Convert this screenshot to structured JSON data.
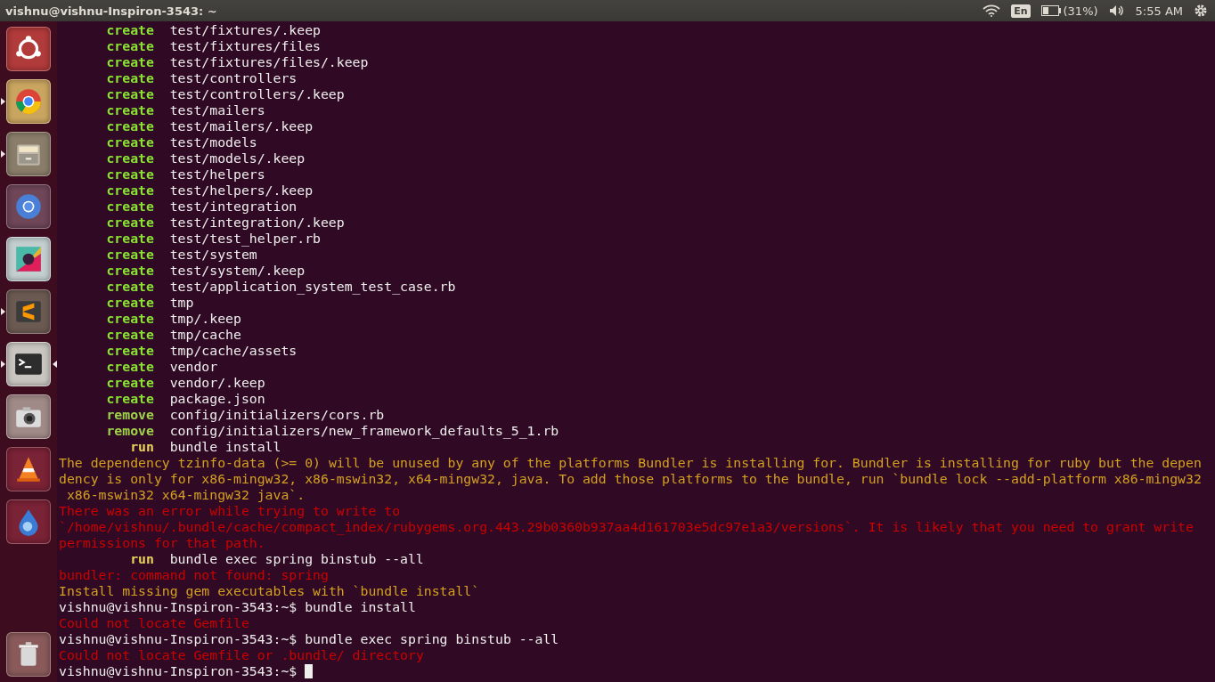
{
  "top_bar": {
    "title": "vishnu@vishnu-Inspiron-3543: ~",
    "keyboard": "En",
    "battery": "(31%)",
    "clock": "5:55 AM"
  },
  "launcher": [
    {
      "running": false,
      "active": false
    },
    {
      "running": true,
      "active": false
    },
    {
      "running": true,
      "active": false
    },
    {
      "running": false,
      "active": false
    },
    {
      "running": false,
      "active": false
    },
    {
      "running": true,
      "active": false
    },
    {
      "running": true,
      "active": true
    },
    {
      "running": false,
      "active": false
    },
    {
      "running": false,
      "active": false
    },
    {
      "running": false,
      "active": false
    },
    {
      "kind": "trash",
      "running": false,
      "active": false
    }
  ],
  "terminal": {
    "lines": [
      {
        "kind": "status",
        "verb": "create",
        "path": "test/fixtures/.keep",
        "color": "#8ae234"
      },
      {
        "kind": "status",
        "verb": "create",
        "path": "test/fixtures/files",
        "color": "#8ae234"
      },
      {
        "kind": "status",
        "verb": "create",
        "path": "test/fixtures/files/.keep",
        "color": "#8ae234"
      },
      {
        "kind": "status",
        "verb": "create",
        "path": "test/controllers",
        "color": "#8ae234"
      },
      {
        "kind": "status",
        "verb": "create",
        "path": "test/controllers/.keep",
        "color": "#8ae234"
      },
      {
        "kind": "status",
        "verb": "create",
        "path": "test/mailers",
        "color": "#8ae234"
      },
      {
        "kind": "status",
        "verb": "create",
        "path": "test/mailers/.keep",
        "color": "#8ae234"
      },
      {
        "kind": "status",
        "verb": "create",
        "path": "test/models",
        "color": "#8ae234"
      },
      {
        "kind": "status",
        "verb": "create",
        "path": "test/models/.keep",
        "color": "#8ae234"
      },
      {
        "kind": "status",
        "verb": "create",
        "path": "test/helpers",
        "color": "#8ae234"
      },
      {
        "kind": "status",
        "verb": "create",
        "path": "test/helpers/.keep",
        "color": "#8ae234"
      },
      {
        "kind": "status",
        "verb": "create",
        "path": "test/integration",
        "color": "#8ae234"
      },
      {
        "kind": "status",
        "verb": "create",
        "path": "test/integration/.keep",
        "color": "#8ae234"
      },
      {
        "kind": "status",
        "verb": "create",
        "path": "test/test_helper.rb",
        "color": "#8ae234"
      },
      {
        "kind": "status",
        "verb": "create",
        "path": "test/system",
        "color": "#8ae234"
      },
      {
        "kind": "status",
        "verb": "create",
        "path": "test/system/.keep",
        "color": "#8ae234"
      },
      {
        "kind": "status",
        "verb": "create",
        "path": "test/application_system_test_case.rb",
        "color": "#8ae234"
      },
      {
        "kind": "status",
        "verb": "create",
        "path": "tmp",
        "color": "#8ae234"
      },
      {
        "kind": "status",
        "verb": "create",
        "path": "tmp/.keep",
        "color": "#8ae234"
      },
      {
        "kind": "status",
        "verb": "create",
        "path": "tmp/cache",
        "color": "#8ae234"
      },
      {
        "kind": "status",
        "verb": "create",
        "path": "tmp/cache/assets",
        "color": "#8ae234"
      },
      {
        "kind": "status",
        "verb": "create",
        "path": "vendor",
        "color": "#8ae234"
      },
      {
        "kind": "status",
        "verb": "create",
        "path": "vendor/.keep",
        "color": "#8ae234"
      },
      {
        "kind": "status",
        "verb": "create",
        "path": "package.json",
        "color": "#8ae234"
      },
      {
        "kind": "status",
        "verb": "remove",
        "path": "config/initializers/cors.rb",
        "color": "#9ed34a"
      },
      {
        "kind": "status",
        "verb": "remove",
        "path": "config/initializers/new_framework_defaults_5_1.rb",
        "color": "#9ed34a"
      },
      {
        "kind": "status",
        "verb": "run",
        "path": "bundle install",
        "color": "#e9d35a"
      },
      {
        "kind": "message",
        "text": "The dependency tzinfo-data (>= 0) will be unused by any of the platforms Bundler is installing for. Bundler is installing for ruby but the depen",
        "color": "#d4a020"
      },
      {
        "kind": "message",
        "text": "dency is only for x86-mingw32, x86-mswin32, x64-mingw32, java. To add those platforms to the bundle, run `bundle lock --add-platform x86-mingw32",
        "color": "#d4a020"
      },
      {
        "kind": "message",
        "text": " x86-mswin32 x64-mingw32 java`.",
        "color": "#d4a020"
      },
      {
        "kind": "message",
        "text": "There was an error while trying to write to",
        "color": "#cc0000"
      },
      {
        "kind": "message",
        "text": "`/home/vishnu/.bundle/cache/compact_index/rubygems.org.443.29b0360b937aa4d161703e5dc97e1a3/versions`. It is likely that you need to grant write",
        "color": "#cc0000"
      },
      {
        "kind": "message",
        "text": "permissions for that path.",
        "color": "#cc0000"
      },
      {
        "kind": "status",
        "verb": "run",
        "path": "bundle exec spring binstub --all",
        "color": "#e9d35a"
      },
      {
        "kind": "message",
        "text": "bundler: command not found: spring",
        "color": "#cc0000"
      },
      {
        "kind": "message",
        "text": "Install missing gem executables with `bundle install`",
        "color": "#d4a020"
      },
      {
        "kind": "prompt",
        "prompt": "vishnu@vishnu-Inspiron-3543:~$",
        "command": "bundle install",
        "cursor": false
      },
      {
        "kind": "message",
        "text": "Could not locate Gemfile",
        "color": "#cc0000"
      },
      {
        "kind": "prompt",
        "prompt": "vishnu@vishnu-Inspiron-3543:~$",
        "command": "bundle exec spring binstub --all",
        "cursor": false
      },
      {
        "kind": "message",
        "text": "Could not locate Gemfile or .bundle/ directory",
        "color": "#cc0000"
      },
      {
        "kind": "prompt",
        "prompt": "vishnu@vishnu-Inspiron-3543:~$",
        "cursor": true
      }
    ]
  }
}
